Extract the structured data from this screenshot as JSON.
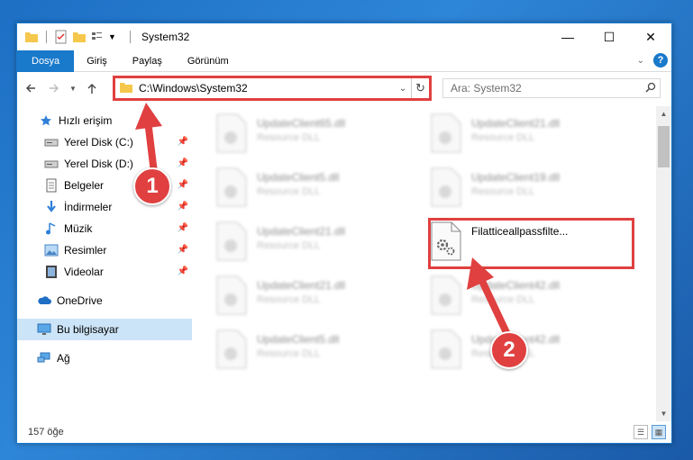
{
  "window": {
    "title": "System32",
    "controls": {
      "minimize": "—",
      "maximize": "☐",
      "close": "✕"
    }
  },
  "ribbon": {
    "tabs": [
      "Dosya",
      "Giriş",
      "Paylaş",
      "Görünüm"
    ],
    "help": "?"
  },
  "address": {
    "path": "C:\\Windows\\System32",
    "search_placeholder": "Ara: System32"
  },
  "sidebar": {
    "items": [
      {
        "label": "Hızlı erişim",
        "icon": "star-icon"
      },
      {
        "label": "Yerel Disk (C:)",
        "icon": "drive-icon",
        "pinned": true
      },
      {
        "label": "Yerel Disk (D:)",
        "icon": "drive-icon",
        "pinned": true
      },
      {
        "label": "Belgeler",
        "icon": "document-icon",
        "pinned": true
      },
      {
        "label": "İndirmeler",
        "icon": "download-icon",
        "pinned": true
      },
      {
        "label": "Müzik",
        "icon": "music-icon",
        "pinned": true
      },
      {
        "label": "Resimler",
        "icon": "pictures-icon",
        "pinned": true
      },
      {
        "label": "Videolar",
        "icon": "videos-icon",
        "pinned": true
      },
      {
        "label": "OneDrive",
        "icon": "cloud-icon"
      },
      {
        "label": "Bu bilgisayar",
        "icon": "computer-icon",
        "selected": true
      },
      {
        "label": "Ağ",
        "icon": "network-icon"
      }
    ]
  },
  "files": [
    {
      "name": "UpdateClient65.dll",
      "type": "Resource DLL"
    },
    {
      "name": "UpdateClient21.dll",
      "type": "Resource DLL"
    },
    {
      "name": "UpdateClient5.dll",
      "type": "Resource DLL"
    },
    {
      "name": "UpdateClient19.dll",
      "type": "Resource DLL"
    },
    {
      "name": "UpdateClient21.dll",
      "type": "Resource DLL"
    },
    {
      "name": "Filatticeallpassfilte...",
      "type": ""
    },
    {
      "name": "UpdateClient21.dll",
      "type": "Resource DLL"
    },
    {
      "name": "UpdateClient42.dll",
      "type": "Resource DLL"
    },
    {
      "name": "UpdateClient5.dll",
      "type": "Resource DLL"
    },
    {
      "name": "UpdateClient42.dll",
      "type": "Resource DLL"
    }
  ],
  "status": {
    "count": "157 öğe"
  },
  "annotations": {
    "step1": "1",
    "step2": "2"
  },
  "colors": {
    "accent": "#1979ca",
    "highlight": "#e04040",
    "selected": "#cce4f7"
  }
}
